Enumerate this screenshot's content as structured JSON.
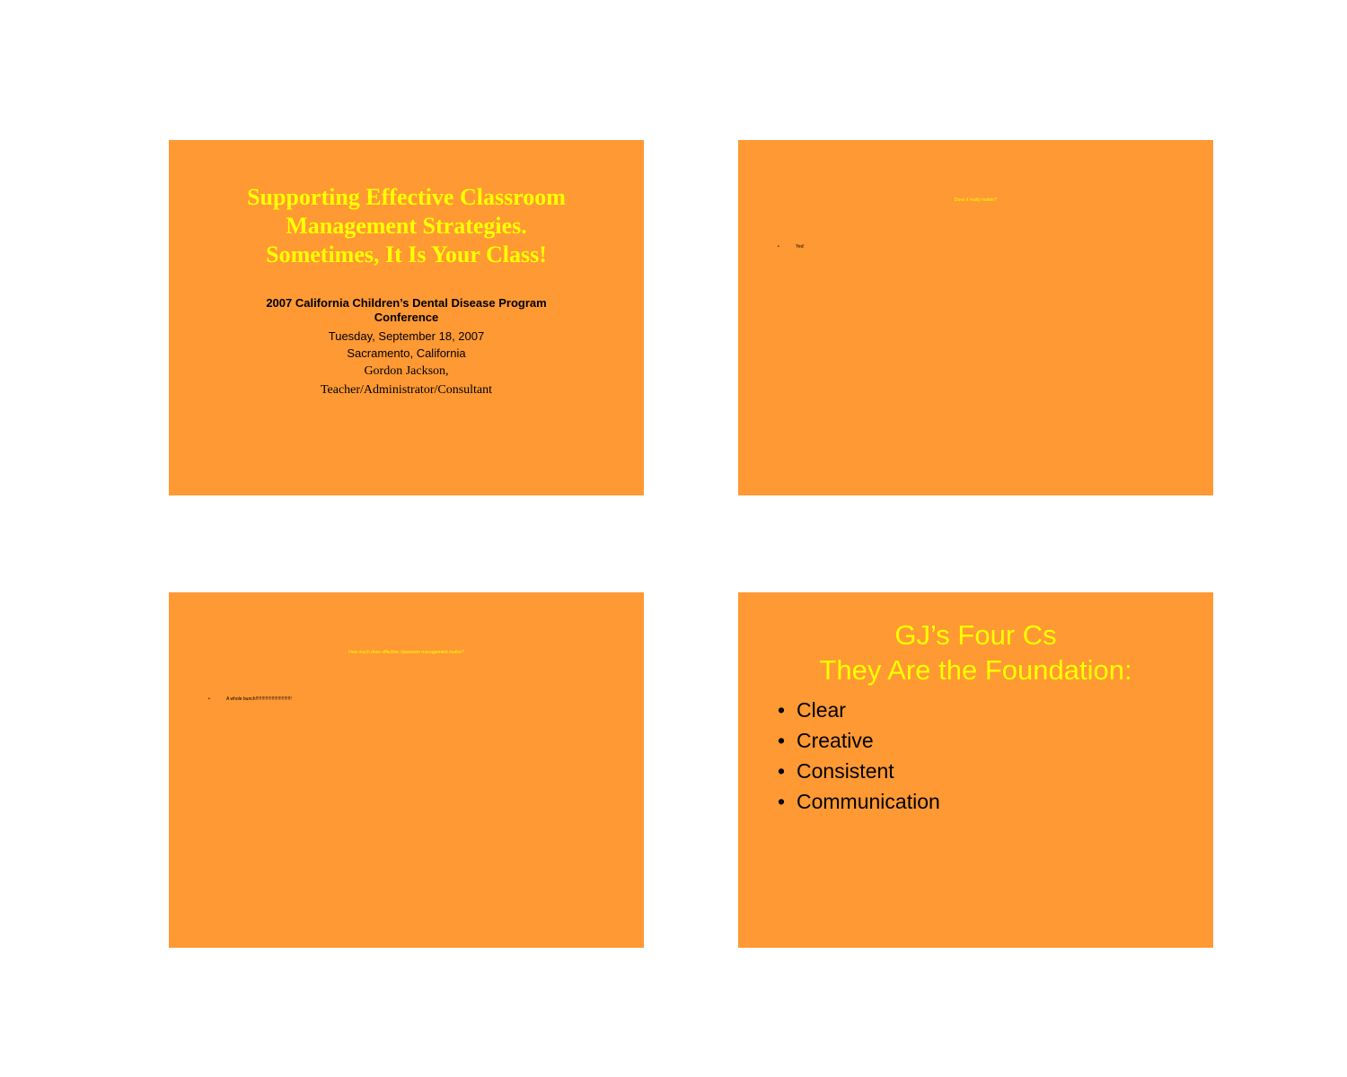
{
  "slides": [
    {
      "title_lines": [
        "Supporting Effective Classroom",
        "Management Strategies.",
        "Sometimes, It Is Your Class!"
      ],
      "conference_lines": [
        "2007 California Children’s Dental Disease Program",
        "Conference"
      ],
      "date": "Tuesday, September 18, 2007",
      "location": "Sacramento, California",
      "presenter": "Gordon Jackson,",
      "role": "Teacher/Administrator/Consultant"
    },
    {
      "title": "Does it really matter?",
      "bullets": [
        "Yes!"
      ]
    },
    {
      "title": "How much does effective classroom management matter?",
      "bullets": [
        "A whole bunch!!!!!!!!!!!!!!!!!!!!!!!!!!!!!"
      ]
    },
    {
      "title_lines": [
        "GJ’s Four Cs",
        "They Are the Foundation:"
      ],
      "bullets": [
        "Clear",
        "Creative",
        "Consistent",
        "Communication"
      ]
    }
  ],
  "bullet_glyph": "•",
  "colors": {
    "slide_background": "#ff9933",
    "title_text": "#ffff00",
    "body_text": "#000000",
    "page_background": "#ffffff"
  }
}
